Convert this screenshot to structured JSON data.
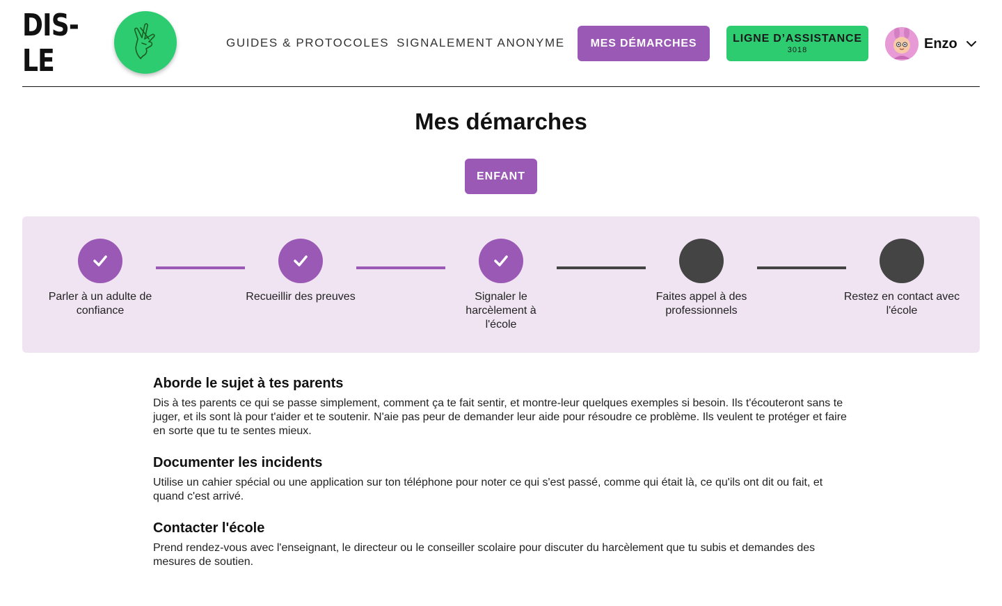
{
  "logo": {
    "text": "DIS-LE",
    "badge_icon": "crossed-fingers-icon",
    "brand_color": "#2ecc71"
  },
  "nav": {
    "guides": "GUIDES & PROTOCOLES",
    "signalement": "SIGNALEMENT ANONYME",
    "demarches": "MES DÉMARCHES",
    "assistance_label": "LIGNE D’ASSISTANCE",
    "assistance_number": "3018"
  },
  "user": {
    "name": "Enzo",
    "avatar_icon": "bunny-avatar-icon"
  },
  "colors": {
    "accent": "#9b59b6",
    "green": "#2ecc71",
    "stepper_bg": "#f0e4f3",
    "inactive": "#444444"
  },
  "page": {
    "title": "Mes démarches",
    "role_button": "ENFANT"
  },
  "steps": [
    {
      "label": "Parler à un adulte de confiance",
      "status": "done"
    },
    {
      "label": "Recueillir des preuves",
      "status": "done"
    },
    {
      "label": "Signaler le harcèlement à l'école",
      "status": "done"
    },
    {
      "label": "Faites appel à des professionnels",
      "status": "todo"
    },
    {
      "label": "Restez en contact avec l'école",
      "status": "todo"
    }
  ],
  "sections": [
    {
      "title": "Aborde le sujet à tes parents",
      "text": "Dis à tes parents ce qui se passe simplement, comment ça te fait sentir, et montre-leur quelques exemples si besoin. Ils t'écouteront sans te juger, et ils sont là pour t'aider et te soutenir. N'aie pas peur de demander leur aide pour résoudre ce problème. Ils veulent te protéger et faire en sorte que tu te sentes mieux."
    },
    {
      "title": "Documenter les incidents",
      "text": "Utilise un cahier spécial ou une application sur ton téléphone pour noter ce qui s'est passé, comme qui était là, ce qu'ils ont dit ou fait, et quand c'est arrivé."
    },
    {
      "title": "Contacter l'école",
      "text": "Prend rendez-vous avec l'enseignant, le directeur ou le conseiller scolaire pour discuter du harcèlement que tu subis et demandes des mesures de soutien."
    }
  ]
}
